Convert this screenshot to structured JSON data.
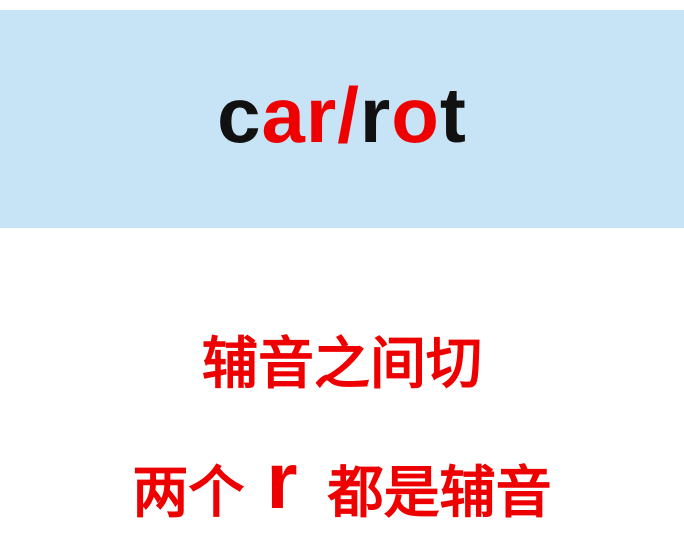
{
  "banner": {
    "word_parts": [
      "c",
      "ar",
      "/",
      "r",
      "o",
      "t"
    ],
    "background_color": "#c7e3f6",
    "text_color": "#111111",
    "highlight_color": "#ee0000"
  },
  "caption": {
    "line1": "辅音之间切",
    "line2_prefix": "两个",
    "line2_letter": "r",
    "line2_suffix": "都是辅音",
    "color": "#ee0000"
  }
}
